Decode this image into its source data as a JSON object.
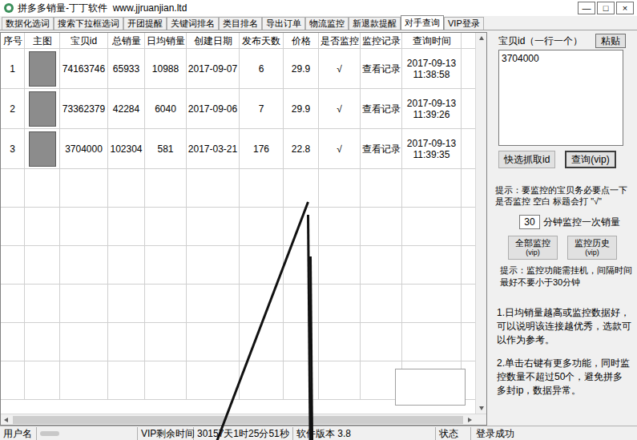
{
  "window": {
    "title": "拼多多销量-丁丁软件  www.jjruanjian.ltd",
    "controls": [
      "—",
      "□",
      "×"
    ]
  },
  "tabs": [
    {
      "label": "数据化选词",
      "selected": false
    },
    {
      "label": "搜索下拉框选词",
      "selected": false
    },
    {
      "label": "开团提醒",
      "selected": false
    },
    {
      "label": "关键词排名",
      "selected": false
    },
    {
      "label": "类目排名",
      "selected": false
    },
    {
      "label": "导出订单",
      "selected": false
    },
    {
      "label": "物流监控",
      "selected": false
    },
    {
      "label": "新退款提醒",
      "selected": false
    },
    {
      "label": "对手查询",
      "selected": true
    },
    {
      "label": "VIP登录",
      "selected": false
    }
  ],
  "table": {
    "columns": [
      "序号",
      "主图",
      "宝贝id",
      "总销量",
      "日均销量",
      "创建日期",
      "发布天数",
      "价格",
      "是否监控",
      "监控记录",
      "查询时间"
    ],
    "rows": [
      {
        "cells": [
          "1",
          "74163746",
          "65933",
          "10988",
          "2017-09-07",
          "6",
          "29.9",
          "√",
          "查看记录",
          "2017-09-13 11:38:58"
        ]
      },
      {
        "cells": [
          "2",
          "73362379",
          "42284",
          "6040",
          "2017-09-06",
          "7",
          "29.9",
          "√",
          "查看记录",
          "2017-09-13 11:39:26"
        ]
      },
      {
        "cells": [
          "3",
          "3704000",
          "102304",
          "581",
          "2017-03-21",
          "176",
          "22.8",
          "√",
          "查看记录",
          "2017-09-13 11:39:35"
        ]
      }
    ]
  },
  "right_panel": {
    "id_label": "宝贝id（一行一个）",
    "paste_button": "粘贴",
    "ids_text": "3704000",
    "fetch_button": "快选抓取id",
    "query_button": "查询(vip)",
    "tip": "提示：要监控的宝贝务必要点一下 是否监控 空白 标题会打 \"√\"",
    "interval": {
      "value": "30",
      "unit": "分钟监控一次销量"
    },
    "monitor_buttons": [
      {
        "line1": "全部监控",
        "line2": "(vip)"
      },
      {
        "line1": "监控历史",
        "line2": "(vip)"
      }
    ],
    "tip2": "提示：监控功能需挂机，间隔时间最好不要小于30分钟",
    "notes": [
      "1.日均销量越高或监控数据好，可以说明该连接越优秀，选款可以作为参考。",
      "2.单击右键有更多功能，同时监控数量不超过50个，避免拼多多封ip，数据异常。"
    ]
  },
  "status_bar": {
    "user_label": "用户名",
    "vip_label": "VIP剩余时间",
    "vip_time": "30157天1时25分51秒",
    "version": "软件版本 3.8",
    "state_label": "状态",
    "state": "登录成功"
  }
}
